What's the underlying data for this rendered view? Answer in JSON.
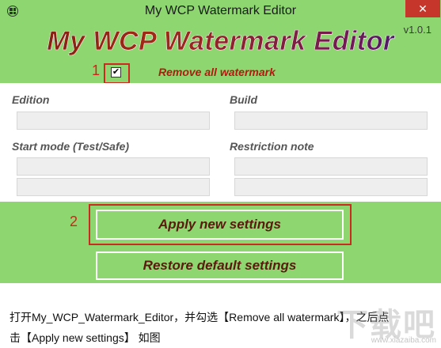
{
  "window": {
    "title": "My WCP Watermark Editor",
    "close_glyph": "✕",
    "header_title": "My WCP Watermark Editor",
    "version": "v1.0.1"
  },
  "options": {
    "remove_watermark_label": "Remove all watermark",
    "remove_watermark_checked": true,
    "checkbox_glyph": "✔"
  },
  "fields": {
    "edition_label": "Edition",
    "build_label": "Build",
    "start_mode_label": "Start mode (Test/Safe)",
    "restriction_label": "Restriction note",
    "edition_value": "",
    "build_value": "",
    "start_mode_value_1": "",
    "start_mode_value_2": "",
    "restriction_value_1": "",
    "restriction_value_2": ""
  },
  "buttons": {
    "apply": "Apply new settings",
    "restore": "Restore default settings"
  },
  "annotations": {
    "step1": "1",
    "step2": "2",
    "color": "#cc2a20"
  },
  "caption": {
    "line1": "打开My_WCP_Watermark_Editor，并勾选【Remove all watermark】，之后点",
    "line2": "击【Apply new settings】 如图"
  },
  "watermark": {
    "logo": "下载吧",
    "url": "www.xiazaiba.com"
  },
  "colors": {
    "window_bg": "#8dd670",
    "close_bg": "#c7362b",
    "label_red": "#b01c10"
  }
}
